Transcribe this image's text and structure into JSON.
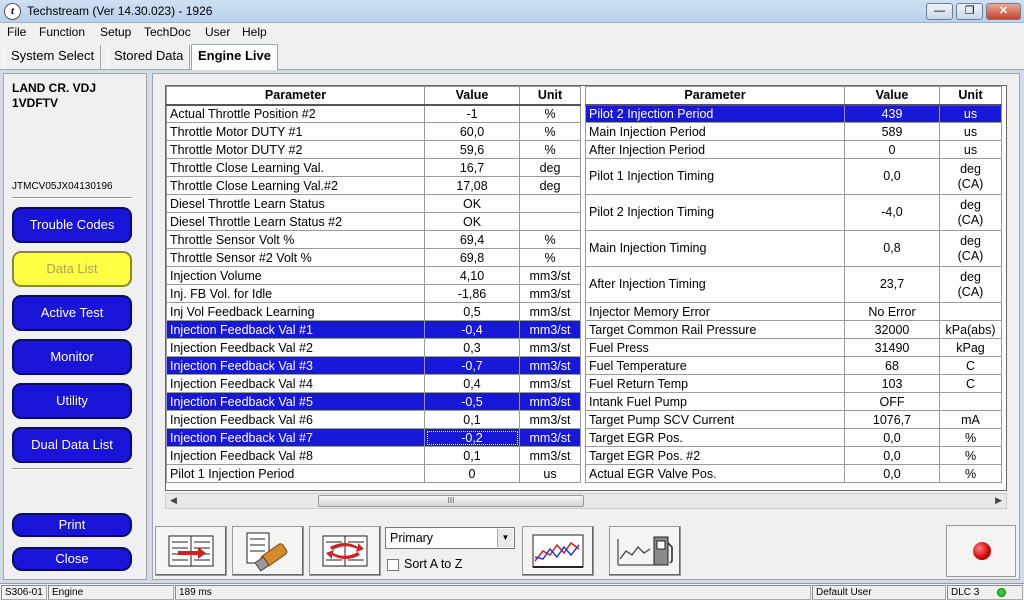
{
  "window": {
    "title": "Techstream (Ver 14.30.023) - 1926",
    "minimize": "—",
    "maximize": "❐",
    "close": "✕",
    "icon_glyph": "t"
  },
  "menu": [
    "File",
    "Function",
    "Setup",
    "TechDoc",
    "User",
    "Help"
  ],
  "tabs": [
    "System Select",
    "Stored Data",
    "Engine Live"
  ],
  "sidebar": {
    "vehicle_line1": "LAND CR. VDJ",
    "vehicle_line2": "1VDFTV",
    "vin": "JTMCV05JX04130196",
    "buttons": [
      "Trouble Codes",
      "Data List",
      "Active Test",
      "Monitor",
      "Utility",
      "Dual Data List"
    ],
    "active_button": "Data List",
    "print": "Print",
    "close": "Close"
  },
  "grid_headers": {
    "parameter": "Parameter",
    "value": "Value",
    "unit": "Unit"
  },
  "left_rows": [
    {
      "p": "Actual Throttle Position #2",
      "v": "-1",
      "u": "%"
    },
    {
      "p": "Throttle Motor DUTY #1",
      "v": "60,0",
      "u": "%"
    },
    {
      "p": "Throttle Motor DUTY #2",
      "v": "59,6",
      "u": "%"
    },
    {
      "p": "Throttle Close Learning Val.",
      "v": "16,7",
      "u": "deg"
    },
    {
      "p": "Throttle Close Learning Val.#2",
      "v": "17,08",
      "u": "deg"
    },
    {
      "p": "Diesel Throttle Learn Status",
      "v": "OK",
      "u": ""
    },
    {
      "p": "Diesel Throttle Learn Status #2",
      "v": "OK",
      "u": ""
    },
    {
      "p": "Throttle Sensor Volt %",
      "v": "69,4",
      "u": "%"
    },
    {
      "p": "Throttle Sensor #2 Volt %",
      "v": "69,8",
      "u": "%"
    },
    {
      "p": "Injection Volume",
      "v": "4,10",
      "u": "mm3/st"
    },
    {
      "p": "Inj. FB Vol. for Idle",
      "v": "-1,86",
      "u": "mm3/st"
    },
    {
      "p": "Inj Vol Feedback Learning",
      "v": "0,5",
      "u": "mm3/st"
    },
    {
      "p": "Injection Feedback Val #1",
      "v": "-0,4",
      "u": "mm3/st"
    },
    {
      "p": "Injection Feedback Val #2",
      "v": "0,3",
      "u": "mm3/st"
    },
    {
      "p": "Injection Feedback Val #3",
      "v": "-0,7",
      "u": "mm3/st"
    },
    {
      "p": "Injection Feedback Val #4",
      "v": "0,4",
      "u": "mm3/st"
    },
    {
      "p": "Injection Feedback Val #5",
      "v": "-0,5",
      "u": "mm3/st"
    },
    {
      "p": "Injection Feedback Val #6",
      "v": "0,1",
      "u": "mm3/st"
    },
    {
      "p": "Injection Feedback Val #7",
      "v": "-0,2",
      "u": "mm3/st"
    },
    {
      "p": "Injection Feedback Val #8",
      "v": "0,1",
      "u": "mm3/st"
    },
    {
      "p": "Pilot 1 Injection Period",
      "v": "0",
      "u": "us"
    }
  ],
  "right_rows": [
    {
      "p": "Pilot 2 Injection Period",
      "v": "439",
      "u": "us"
    },
    {
      "p": "Main Injection Period",
      "v": "589",
      "u": "us"
    },
    {
      "p": "After Injection Period",
      "v": "0",
      "u": "us"
    },
    {
      "p": "Pilot 1 Injection Timing",
      "v": "0,0",
      "u1": "deg",
      "u2": "(CA)"
    },
    {
      "p": "Pilot 2 Injection Timing",
      "v": "-4,0",
      "u1": "deg",
      "u2": "(CA)"
    },
    {
      "p": "Main Injection Timing",
      "v": "0,8",
      "u1": "deg",
      "u2": "(CA)"
    },
    {
      "p": "After Injection Timing",
      "v": "23,7",
      "u1": "deg",
      "u2": "(CA)"
    },
    {
      "p": "Injector Memory Error",
      "v": "No Error",
      "u": ""
    },
    {
      "p": "Target Common Rail Pressure",
      "v": "32000",
      "u": "kPa(abs)"
    },
    {
      "p": "Fuel Press",
      "v": "31490",
      "u": "kPag"
    },
    {
      "p": "Fuel Temperature",
      "v": "68",
      "u": "C"
    },
    {
      "p": "Fuel Return Temp",
      "v": "103",
      "u": "C"
    },
    {
      "p": "Intank Fuel Pump",
      "v": "OFF",
      "u": ""
    },
    {
      "p": "Target Pump SCV Current",
      "v": "1076,7",
      "u": "mA"
    },
    {
      "p": "Target EGR Pos.",
      "v": "0,0",
      "u": "%"
    },
    {
      "p": "Target EGR Pos. #2",
      "v": "0,0",
      "u": "%"
    },
    {
      "p": "Actual EGR Valve Pos.",
      "v": "0,0",
      "u": "%"
    }
  ],
  "toolbar": {
    "select_value": "Primary",
    "sort_label": "Sort A to Z",
    "scroll_grip": "III"
  },
  "status": {
    "code": "S306-01",
    "system": "Engine",
    "interval": "189 ms",
    "user": "Default User",
    "dlc": "DLC 3"
  }
}
